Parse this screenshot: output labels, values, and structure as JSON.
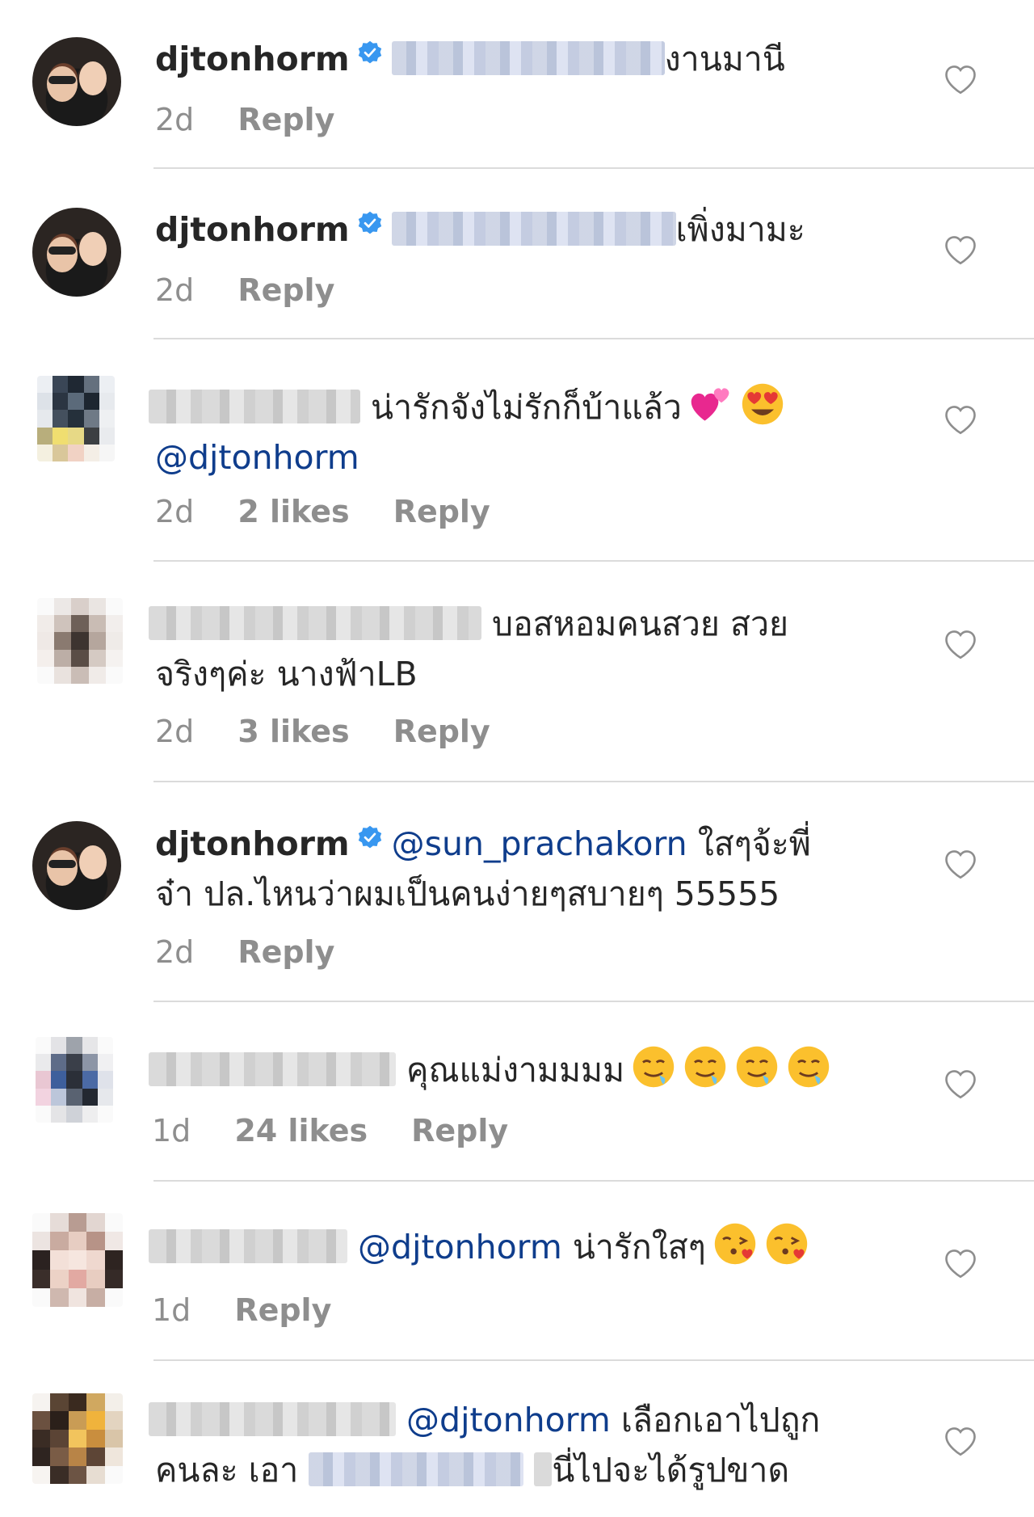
{
  "comments": [
    {
      "username": "djtonhorm",
      "verified": true,
      "text": "งานมานี",
      "time": "2d",
      "likes": "",
      "reply": "Reply"
    },
    {
      "username": "djtonhorm",
      "verified": true,
      "text": "เพิ่งมามะ",
      "time": "2d",
      "likes": "",
      "reply": "Reply"
    },
    {
      "username": "",
      "verified": false,
      "text": "น่ารักจังไม่รักก็บ้าแล้ว",
      "mention": "@djtonhorm",
      "time": "2d",
      "likes": "2 likes",
      "reply": "Reply"
    },
    {
      "username": "",
      "verified": false,
      "text_line1": "บอสหอมคนสวย สวย",
      "text_line2": "จริงๆค่ะ นางฟ้าLB",
      "time": "2d",
      "likes": "3 likes",
      "reply": "Reply"
    },
    {
      "username": "djtonhorm",
      "verified": true,
      "mention": "@sun_prachakorn",
      "text_line1": "ใสๆจ้ะพี่",
      "text_line2": "จ๋า ปล.ไหนว่าผมเป็นคนง่ายๆสบายๆ 55555",
      "time": "2d",
      "likes": "",
      "reply": "Reply"
    },
    {
      "username": "",
      "verified": false,
      "text": "คุณแม่งามมมม",
      "time": "1d",
      "likes": "24 likes",
      "reply": "Reply"
    },
    {
      "username": "",
      "verified": false,
      "mention": "@djtonhorm",
      "text": "น่ารักใสๆ",
      "time": "1d",
      "likes": "",
      "reply": "Reply"
    },
    {
      "username": "",
      "verified": false,
      "mention": "@djtonhorm",
      "text_line1": "เลือกเอาไปถูก",
      "text_line2a": "คนละ เอา",
      "text_line2b": "นี่ไปจะได้รูปขาด"
    }
  ],
  "icons": {
    "verified": "verified-badge-icon",
    "heart": "heart-outline-icon"
  },
  "colors": {
    "mention": "#0f3d8c",
    "meta": "#8e8e8e",
    "verified": "#3897f0"
  }
}
